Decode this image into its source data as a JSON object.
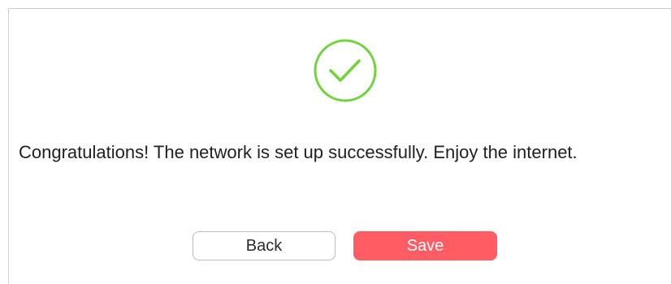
{
  "icon": {
    "name": "checkmark-circle-icon",
    "color": "#6fd43a"
  },
  "message": {
    "text": "Congratulations! The network is set up successfully. Enjoy the internet."
  },
  "actions": {
    "back_label": "Back",
    "save_label": "Save",
    "save_color": "#ff5c63"
  }
}
